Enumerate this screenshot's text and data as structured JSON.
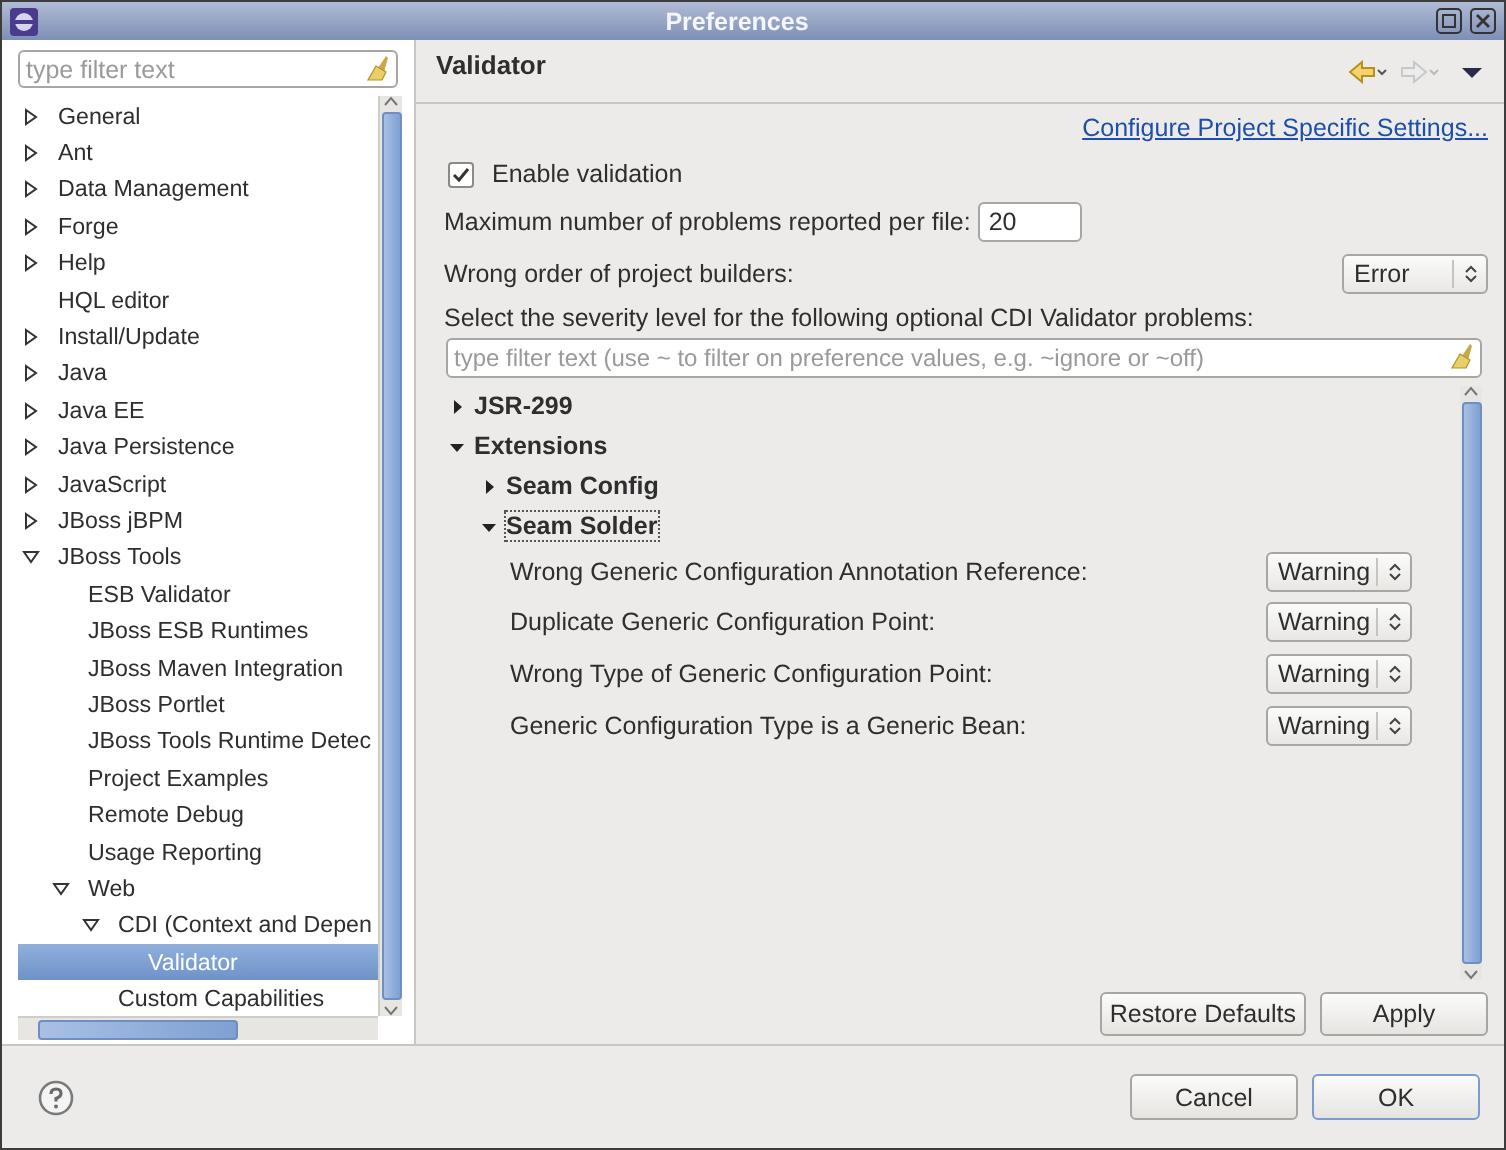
{
  "window": {
    "title": "Preferences"
  },
  "filter": {
    "placeholder": "type filter text"
  },
  "tree": [
    {
      "label": "General",
      "expanded": false,
      "selected": false
    },
    {
      "label": "Ant",
      "expanded": false,
      "selected": false
    },
    {
      "label": "Data Management",
      "expanded": false,
      "selected": false
    },
    {
      "label": "Forge",
      "expanded": false,
      "selected": false
    },
    {
      "label": "Help",
      "expanded": false,
      "selected": false
    },
    {
      "label": "HQL editor",
      "selected": false
    },
    {
      "label": "Install/Update",
      "expanded": false,
      "selected": false
    },
    {
      "label": "Java",
      "expanded": false,
      "selected": false
    },
    {
      "label": "Java EE",
      "expanded": false,
      "selected": false
    },
    {
      "label": "Java Persistence",
      "expanded": false,
      "selected": false
    },
    {
      "label": "JavaScript",
      "expanded": false,
      "selected": false
    },
    {
      "label": "JBoss jBPM",
      "expanded": false,
      "selected": false
    },
    {
      "label": "JBoss Tools",
      "expanded": true,
      "selected": false,
      "children": [
        {
          "label": "ESB Validator",
          "selected": false
        },
        {
          "label": "JBoss ESB Runtimes",
          "selected": false
        },
        {
          "label": "JBoss Maven Integration",
          "selected": false
        },
        {
          "label": "JBoss Portlet",
          "selected": false
        },
        {
          "label": "JBoss Tools Runtime Detec",
          "selected": false
        },
        {
          "label": "Project Examples",
          "selected": false
        },
        {
          "label": "Remote Debug",
          "selected": false
        },
        {
          "label": "Usage Reporting",
          "selected": false
        },
        {
          "label": "Web",
          "expanded": true,
          "selected": false,
          "children": [
            {
              "label": "CDI (Context and Depen",
              "expanded": true,
              "selected": false,
              "children": [
                {
                  "label": "Validator",
                  "selected": true
                }
              ]
            },
            {
              "label": "Custom Capabilities",
              "selected": false
            }
          ]
        }
      ]
    }
  ],
  "page": {
    "title": "Validator",
    "nav": {
      "back": {
        "disabled": false
      },
      "forward": {
        "disabled": true
      }
    },
    "link": "Configure Project Specific Settings...",
    "enable": {
      "label": "Enable validation",
      "checked": true
    },
    "max_problems": {
      "label": "Maximum number of problems reported per file:",
      "value": "20"
    },
    "builder_order": {
      "label": "Wrong order of project builders:",
      "value": "Error"
    },
    "severity_prompt": "Select the severity level for the following optional CDI Validator problems:",
    "severity_filter": {
      "placeholder": "type filter text (use ~ to filter on preference values, e.g. ~ignore or ~off)"
    },
    "sections": [
      {
        "label": "JSR-299",
        "expanded": false
      },
      {
        "label": "Extensions",
        "expanded": true,
        "children": [
          {
            "label": "Seam Config",
            "expanded": false,
            "focused": false
          },
          {
            "label": "Seam Solder",
            "expanded": true,
            "focused": true,
            "settings": [
              {
                "label": "Wrong Generic Configuration Annotation Reference:",
                "value": "Warning"
              },
              {
                "label": "Duplicate Generic Configuration Point:",
                "value": "Warning"
              },
              {
                "label": "Wrong Type of Generic Configuration Point:",
                "value": "Warning"
              },
              {
                "label": "Generic Configuration Type is a Generic Bean:",
                "value": "Warning"
              }
            ]
          }
        ]
      }
    ],
    "buttons": [
      "Restore Defaults",
      "Apply"
    ]
  },
  "dialog_buttons": [
    {
      "label": "Cancel",
      "default": false
    },
    {
      "label": "OK",
      "default": true
    }
  ]
}
